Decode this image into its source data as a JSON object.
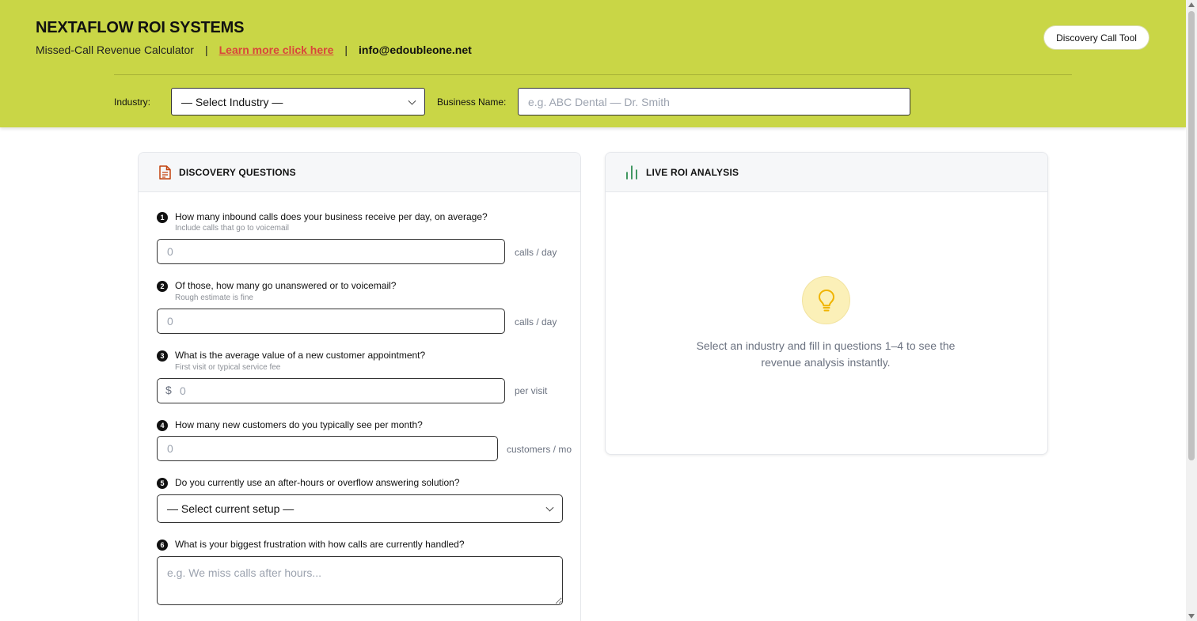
{
  "header": {
    "brand": "NEXTAFLOW ROI SYSTEMS",
    "subtitle": "Missed-Call Revenue Calculator",
    "separator": "|",
    "learn_more": "Learn more click here",
    "email": "info@edoubleone.net",
    "call_tool_button": "Discovery Call Tool",
    "industry_label": "Industry:",
    "industry_select": "— Select Industry —",
    "business_label": "Business Name:",
    "business_placeholder": "e.g. ABC Dental — Dr. Smith"
  },
  "discovery": {
    "title": "DISCOVERY QUESTIONS",
    "questions": [
      {
        "num": "1",
        "text": "How many inbound calls does your business receive per day, on average?",
        "hint": "Include calls that go to voicemail",
        "placeholder": "0",
        "unit": "calls / day"
      },
      {
        "num": "2",
        "text": "Of those, how many go unanswered or to voicemail?",
        "hint": "Rough estimate is fine",
        "placeholder": "0",
        "unit": "calls / day"
      },
      {
        "num": "3",
        "text": "What is the average value of a new customer appointment?",
        "hint": "First visit or typical service fee",
        "placeholder": "0",
        "prefix": "$",
        "unit": "per visit"
      },
      {
        "num": "4",
        "text": "How many new customers do you typically see per month?",
        "placeholder": "0",
        "unit": "customers / mo"
      },
      {
        "num": "5",
        "text": "Do you currently use an after-hours or overflow answering solution?",
        "select": "— Select current setup —"
      },
      {
        "num": "6",
        "text": "What is your biggest frustration with how calls are currently handled?",
        "placeholder": "e.g. We miss calls after hours..."
      }
    ]
  },
  "roi": {
    "title": "LIVE ROI ANALYSIS",
    "empty_message": "Select an industry and fill in questions 1–4 to see the revenue analysis instantly."
  },
  "colors": {
    "header_bg": "#c9d646",
    "link": "#d9463b",
    "doc_icon": "#c2410c",
    "chart_icon": "#15803d",
    "bulb": "#f0b400"
  },
  "icons": {
    "discovery": "document-icon",
    "roi": "bar-chart-icon",
    "empty": "lightbulb-icon"
  }
}
